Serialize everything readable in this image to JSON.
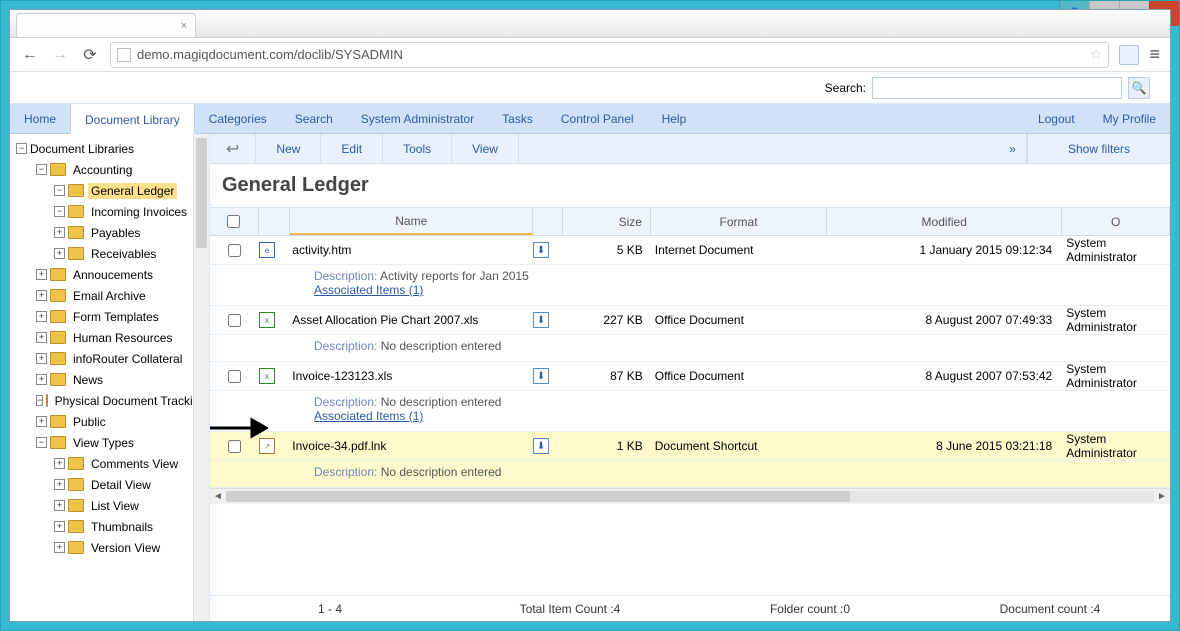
{
  "url": "demo.magiqdocument.com/doclib/SYSADMIN",
  "search": {
    "label": "Search:",
    "placeholder": ""
  },
  "topnav": {
    "tabs": [
      "Home",
      "Document Library",
      "Categories",
      "Search",
      "System Administrator",
      "Tasks",
      "Control Panel",
      "Help"
    ],
    "right": [
      "Logout",
      "My Profile"
    ],
    "active_index": 1
  },
  "sidebar": {
    "root": "Document Libraries",
    "nodes": [
      {
        "label": "Accounting",
        "depth": 1,
        "expanded": true
      },
      {
        "label": "General Ledger",
        "depth": 2,
        "expanded": true,
        "selected": true
      },
      {
        "label": "Incoming Invoices",
        "depth": 2,
        "expanded": true
      },
      {
        "label": "Payables",
        "depth": 2,
        "expanded": false
      },
      {
        "label": "Receivables",
        "depth": 2,
        "expanded": false
      },
      {
        "label": "Annoucements",
        "depth": 1,
        "expanded": false
      },
      {
        "label": "Email Archive",
        "depth": 1,
        "expanded": false
      },
      {
        "label": "Form Templates",
        "depth": 1,
        "expanded": false
      },
      {
        "label": "Human Resources",
        "depth": 1,
        "expanded": false
      },
      {
        "label": "infoRouter Collateral",
        "depth": 1,
        "expanded": false
      },
      {
        "label": "News",
        "depth": 1,
        "expanded": false
      },
      {
        "label": "Physical Document Tracking",
        "depth": 1,
        "expanded": true
      },
      {
        "label": "Public",
        "depth": 1,
        "expanded": false
      },
      {
        "label": "View Types",
        "depth": 1,
        "expanded": true
      },
      {
        "label": "Comments View",
        "depth": 2,
        "expanded": false
      },
      {
        "label": "Detail View",
        "depth": 2,
        "expanded": false
      },
      {
        "label": "List View",
        "depth": 2,
        "expanded": false
      },
      {
        "label": "Thumbnails",
        "depth": 2,
        "expanded": false
      },
      {
        "label": "Version View",
        "depth": 2,
        "expanded": false
      }
    ]
  },
  "toolbar": {
    "buttons": [
      "New",
      "Edit",
      "Tools",
      "View"
    ],
    "filters": "Show filters"
  },
  "heading": "General Ledger",
  "columns": [
    "",
    "",
    "Name",
    "",
    "Size",
    "Format",
    "Modified",
    "O"
  ],
  "desc_label": "Description:",
  "assoc_label": "Associated Items (1)",
  "rows": [
    {
      "name": "activity.htm",
      "icon": "htm",
      "size": "5 KB",
      "format": "Internet Document",
      "modified": "1 January 2015 09:12:34",
      "owner": "System Administrator",
      "desc": "Activity reports for Jan 2015",
      "assoc": true,
      "hl": false
    },
    {
      "name": "Asset Allocation Pie Chart 2007.xls",
      "icon": "xls",
      "size": "227 KB",
      "format": "Office Document",
      "modified": "8 August 2007 07:49:33",
      "owner": "System Administrator",
      "desc": "No description entered",
      "assoc": false,
      "hl": false
    },
    {
      "name": "Invoice-123123.xls",
      "icon": "xls",
      "size": "87 KB",
      "format": "Office Document",
      "modified": "8 August 2007 07:53:42",
      "owner": "System Administrator",
      "desc": "No description entered",
      "assoc": true,
      "hl": false
    },
    {
      "name": "Invoice-34.pdf.lnk",
      "icon": "lnk",
      "size": "1 KB",
      "format": "Document Shortcut",
      "modified": "8 June 2015 03:21:18",
      "owner": "System Administrator",
      "desc": "No description entered",
      "assoc": false,
      "hl": true
    }
  ],
  "status": {
    "range": "1 - 4",
    "total": "Total Item Count :4",
    "folders": "Folder count :0",
    "docs": "Document count :4"
  }
}
